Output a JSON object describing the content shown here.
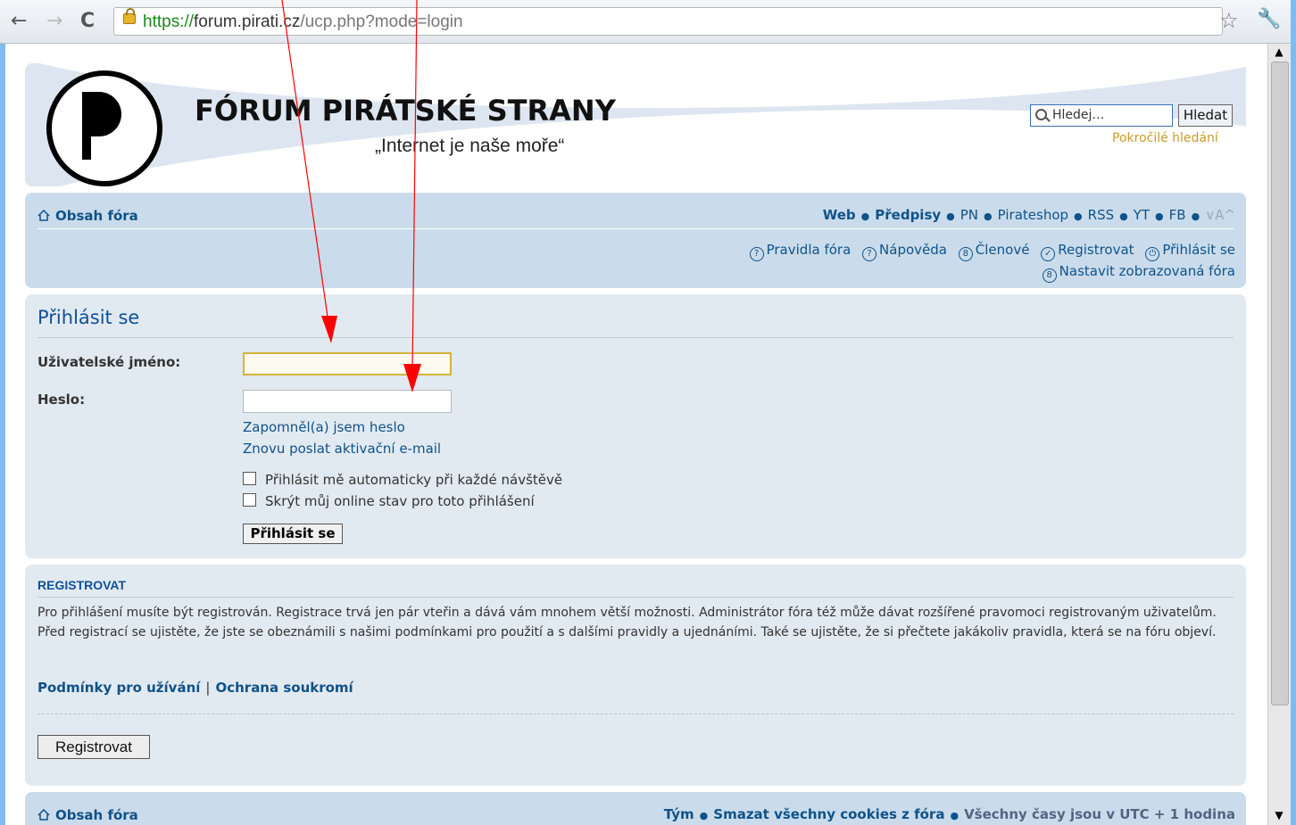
{
  "browser": {
    "url_scheme": "https://",
    "url_host": "forum.pirati.cz",
    "url_path": "/ucp.php?mode=login",
    "back_label": "←",
    "forward_label": "→",
    "reload_label": "C"
  },
  "header": {
    "title": "FÓRUM PIRÁTSKÉ STRANY",
    "tagline": "„Internet je naše moře“",
    "search_placeholder": "Hledej…",
    "search_button": "Hledat",
    "advanced_search": "Pokročilé hledání"
  },
  "navbar": {
    "index_label": "Obsah fóra",
    "top_links": [
      "Web",
      "Předpisy",
      "PN",
      "Pirateshop",
      "RSS",
      "YT",
      "FB"
    ],
    "font_toggle": "∨A^",
    "menu": [
      "Pravidla fóra",
      "Nápověda",
      "Členové",
      "Registrovat",
      "Přihlásit se"
    ],
    "menu2": "Nastavit zobrazovaná fóra"
  },
  "login": {
    "title": "Přihlásit se",
    "username_label": "Uživatelské jméno:",
    "password_label": "Heslo:",
    "forgot_password": "Zapomněl(a) jsem heslo",
    "resend_activation": "Znovu poslat aktivační e-mail",
    "autologin_label": "Přihlásit mě automaticky při každé návštěvě",
    "hide_online_label": "Skrýt můj online stav pro toto přihlášení",
    "submit": "Přihlásit se"
  },
  "register": {
    "title": "REGISTROVAT",
    "text": "Pro přihlášení musíte být registrován. Registrace trvá jen pár vteřin a dává vám mnohem větší možnosti. Administrátor fóra též může dávat rozšířené pravomoci registrovaným uživatelům. Před registrací se ujistěte, že jste se obeznámili s našimi podmínkami pro použití a s dalšími pravidly a ujednáními. Také se ujistěte, že si přečtete jakákoliv pravidla, která se na fóru objeví.",
    "terms_link": "Podmínky pro užívání",
    "privacy_link": "Ochrana soukromí",
    "button": "Registrovat"
  },
  "footer": {
    "index_label": "Obsah fóra",
    "team": "Tým",
    "delete_cookies": "Smazat všechny cookies z fóra",
    "timezone": "Všechny časy jsou v UTC + 1 hodina"
  },
  "colors": {
    "link": "#105289",
    "panel": "#e2eaf1",
    "navbar": "#cadceb",
    "annotation_arrow": "#ff0000"
  }
}
